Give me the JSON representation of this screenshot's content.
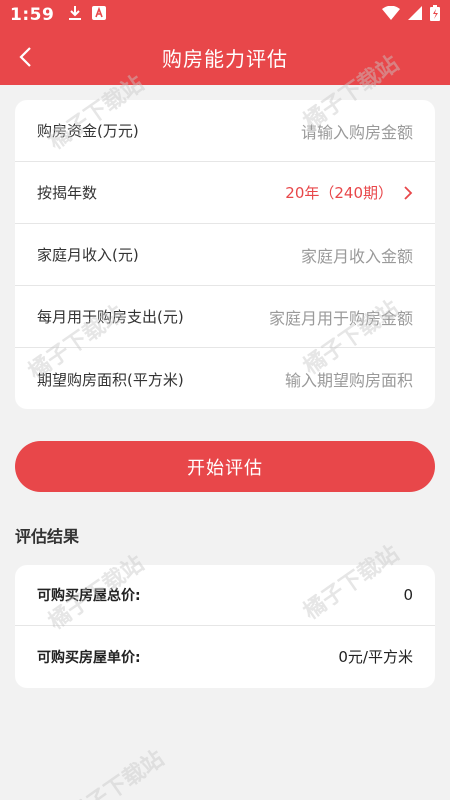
{
  "status_bar": {
    "time": "1:59",
    "icons": [
      "download-icon",
      "app-a-icon",
      "wifi-icon",
      "signal-icon",
      "battery-icon"
    ]
  },
  "app_bar": {
    "back_icon": "chevron-left-icon",
    "title": "购房能力评估"
  },
  "form": {
    "rows": [
      {
        "label": "购房资金(万元)",
        "placeholder": "请输入购房金额"
      },
      {
        "label": "按揭年数",
        "value": "20年（240期）",
        "icon": "chevron-right-icon"
      },
      {
        "label": "家庭月收入(元)",
        "placeholder": "家庭月收入金额"
      },
      {
        "label": "每月用于购房支出(元)",
        "placeholder": "家庭月用于购房金额"
      },
      {
        "label": "期望购房面积(平方米)",
        "placeholder": "输入期望购房面积"
      }
    ]
  },
  "start_button": "开始评估",
  "result": {
    "title": "评估结果",
    "rows": [
      {
        "label": "可购买房屋总价:",
        "value": "0"
      },
      {
        "label": "可购买房屋单价:",
        "value": "0元/平方米"
      }
    ]
  },
  "watermark": "橘子下载站",
  "colors": {
    "accent": "#e8474a",
    "background": "#f2f2f2"
  }
}
